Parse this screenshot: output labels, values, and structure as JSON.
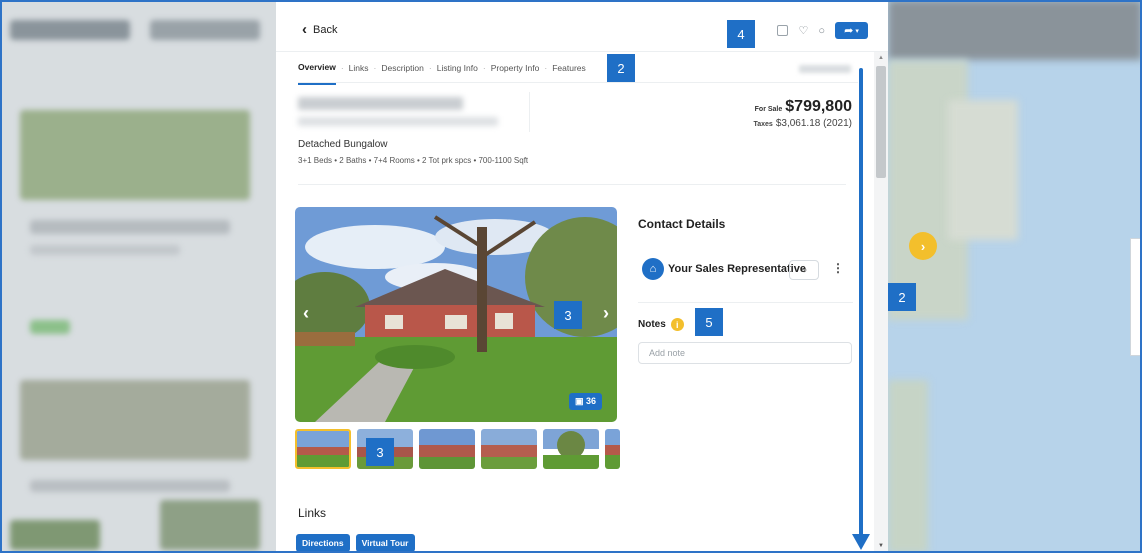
{
  "nav": {
    "back_label": "Back"
  },
  "tabs": [
    "Overview",
    "Links",
    "Description",
    "Listing Info",
    "Property Info",
    "Features"
  ],
  "listing": {
    "sale_label": "For Sale",
    "price": "$799,800",
    "taxes_label": "Taxes",
    "taxes": "$3,061.18 (2021)",
    "property_type": "Detached Bungalow",
    "features": "3+1 Beds  •  2 Baths  •  7+4 Rooms  •  2 Tot prk spcs  •  700-1100 Sqft"
  },
  "photos": {
    "count": "36"
  },
  "contact": {
    "title": "Contact Details",
    "rep_name": "Your Sales Representative"
  },
  "notes": {
    "label": "Notes",
    "placeholder": "Add note"
  },
  "links": {
    "title": "Links",
    "buttons": [
      "Directions",
      "Virtual Tour"
    ]
  },
  "callouts": [
    "4",
    "2",
    "2",
    "3",
    "3",
    "5"
  ],
  "colors": {
    "accent": "#1f6fc6",
    "highlight": "#f3bf2c"
  },
  "icons": [
    "chevron-left-icon",
    "heart-icon",
    "chat-icon",
    "share-icon",
    "camera-icon",
    "more-icon",
    "info-icon"
  ]
}
